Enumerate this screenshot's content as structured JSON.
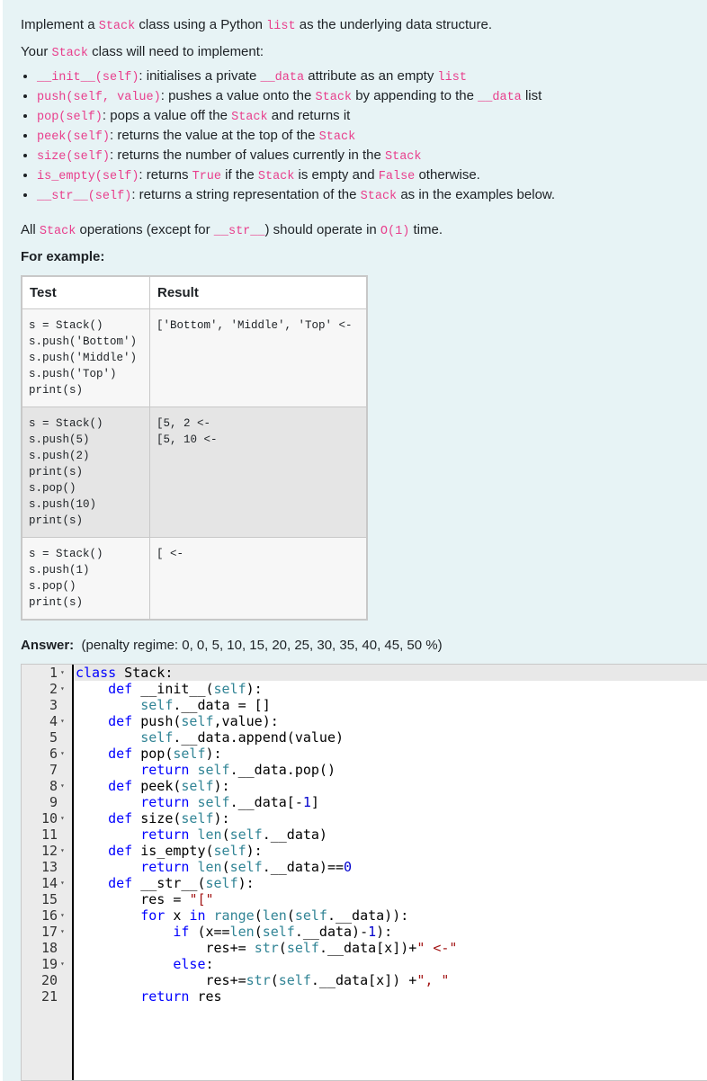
{
  "intro": {
    "l1_a": "Implement a ",
    "l1_b": "Stack",
    "l1_c": " class using a Python ",
    "l1_d": "list",
    "l1_e": " as the underlying data structure.",
    "l2_a": "Your ",
    "l2_b": "Stack",
    "l2_c": " class will need to implement:"
  },
  "spec": [
    {
      "code": "__init__(self)",
      "t1": ": initialises a private ",
      "c2": "__data",
      "t2": " attribute as an empty ",
      "c3": "list",
      "t3": ""
    },
    {
      "code": "push(self, value)",
      "t1": ": pushes a value onto the ",
      "c2": "Stack",
      "t2": " by appending to the ",
      "c3": "__data",
      "t3": " list"
    },
    {
      "code": "pop(self)",
      "t1": ": pops a value off the ",
      "c2": "Stack",
      "t2": " and returns it",
      "c3": "",
      "t3": ""
    },
    {
      "code": "peek(self)",
      "t1": ": returns the value at the top of the ",
      "c2": "Stack",
      "t2": "",
      "c3": "",
      "t3": ""
    },
    {
      "code": "size(self)",
      "t1": ": returns the number of values currently in the ",
      "c2": "Stack",
      "t2": "",
      "c3": "",
      "t3": ""
    },
    {
      "code": "is_empty(self)",
      "t1": ": returns ",
      "c2": "True",
      "t2": " if the ",
      "c3": "Stack",
      "t3": " is empty and ",
      "c4": "False",
      "t4": " otherwise."
    },
    {
      "code": "__str__(self)",
      "t1": ": returns a string representation of the ",
      "c2": "Stack",
      "t2": " as in the examples below.",
      "c3": "",
      "t3": ""
    }
  ],
  "ops": {
    "a": "All ",
    "b": "Stack",
    "c": " operations (except for ",
    "d": "__str__",
    "e": ") should operate in ",
    "f": "O(1)",
    "g": " time."
  },
  "for_example": "For example:",
  "table": {
    "headers": [
      "Test",
      "Result"
    ],
    "rows": [
      {
        "test": "s = Stack()\ns.push('Bottom')\ns.push('Middle')\ns.push('Top')\nprint(s)",
        "result": "['Bottom', 'Middle', 'Top' <-"
      },
      {
        "test": "s = Stack()\ns.push(5)\ns.push(2)\nprint(s)\ns.pop()\ns.push(10)\nprint(s)",
        "result": "[5, 2 <-\n[5, 10 <-"
      },
      {
        "test": "s = Stack()\ns.push(1)\ns.pop()\nprint(s)",
        "result": "[ <-"
      }
    ]
  },
  "answer": {
    "label": "Answer:",
    "penalty": "(penalty regime: 0, 0, 5, 10, 15, 20, 25, 30, 35, 40, 45, 50 %)"
  },
  "code_lines": [
    "class Stack:",
    "    def __init__(self):",
    "        self.__data = []",
    "    def push(self,value):",
    "        self.__data.append(value)",
    "    def pop(self):",
    "        return self.__data.pop()",
    "    def peek(self):",
    "        return self.__data[-1]",
    "    def size(self):",
    "        return len(self.__data)",
    "    def is_empty(self):",
    "        return len(self.__data)==0",
    "    def __str__(self):",
    "        res = \"[\"",
    "        for x in range(len(self.__data)):",
    "            if (x==len(self.__data)-1):",
    "                res+= str(self.__data[x])+\" <-\"",
    "            else:",
    "                res+=str(self.__data[x]) +\", \"",
    "        return res"
  ],
  "foldable_lines": [
    1,
    2,
    4,
    6,
    8,
    10,
    12,
    14,
    16,
    17,
    19
  ]
}
